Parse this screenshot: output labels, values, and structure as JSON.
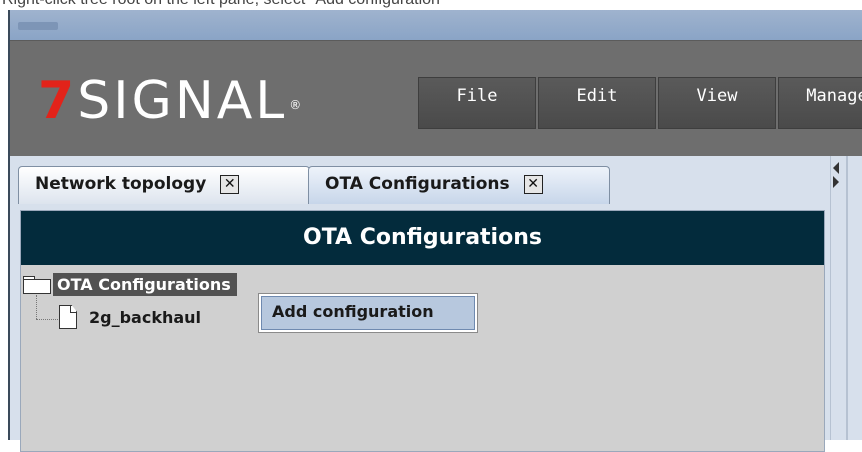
{
  "caption": "Right-click tree root on the left pane, select \"Add configuration\"",
  "logo": {
    "seven": "7",
    "word": "SIGNAL",
    "reg": "®"
  },
  "menu": [
    {
      "label": "File"
    },
    {
      "label": "Edit"
    },
    {
      "label": "View"
    },
    {
      "label": "Manage"
    }
  ],
  "tabs": [
    {
      "label": "Network topology",
      "close": "✕"
    },
    {
      "label": "OTA Configurations",
      "close": "✕"
    }
  ],
  "pane": {
    "header": "OTA Configurations",
    "tree": {
      "root": "OTA Configurations",
      "children": [
        {
          "label": "2g_backhaul"
        }
      ]
    },
    "context_menu": {
      "items": [
        {
          "label": "Add configuration"
        }
      ]
    }
  },
  "colors": {
    "logo_red": "#e2231a",
    "header_bg": "#032b3c",
    "banner_bg": "#6e6e6e",
    "selection_bg": "#525252",
    "menu_highlight": "#b7c8de"
  }
}
